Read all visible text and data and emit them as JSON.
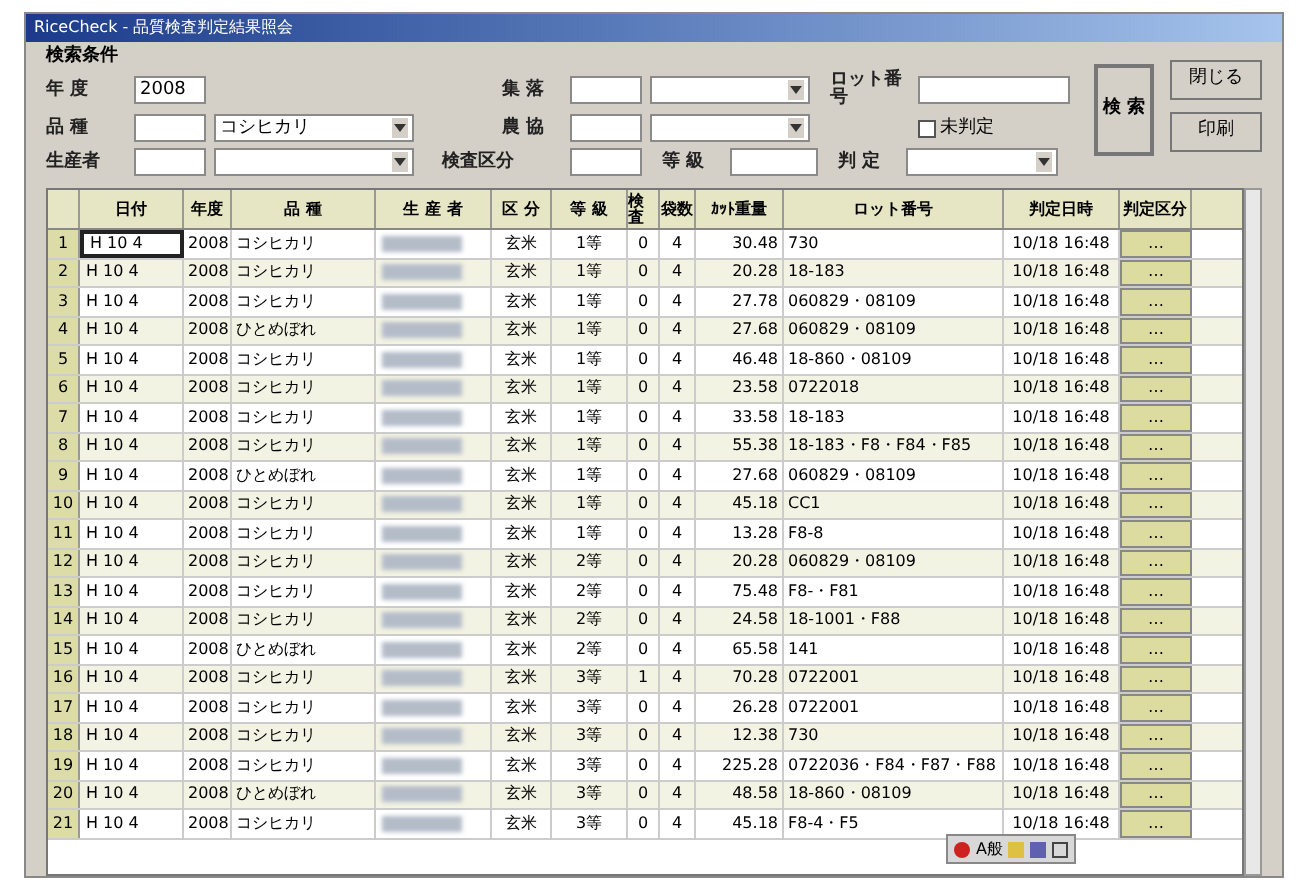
{
  "window": {
    "title": "RiceCheck - 品質検査判定結果照会"
  },
  "search": {
    "heading": "検索条件",
    "fields": [
      {
        "label": "年 度",
        "value": "2008"
      },
      {
        "label": "品 種",
        "value2": "コシヒカリ"
      },
      {
        "label": "生産者"
      },
      {
        "label": "集 落"
      },
      {
        "label": "農 協"
      },
      {
        "label": "検査区分"
      },
      {
        "label": "等 級"
      },
      {
        "label": "ロット番号"
      },
      {
        "label": "判 定"
      }
    ],
    "checkbox": {
      "label": "未判定",
      "checked": false
    },
    "buttons": [
      "検 索",
      "閉じる",
      "印刷"
    ]
  },
  "table": {
    "columns": [
      "",
      "日付",
      "年度",
      "品 種",
      "生 産 者",
      "区 分",
      "等 級",
      "検査",
      "袋数",
      "ｶｯﾄ重量",
      "ロット番号",
      "判定日時",
      "判定区分"
    ],
    "rows": [
      {
        "no": "1",
        "date": "H 10 4",
        "year": "2008",
        "variety": "コシヒカリ",
        "kubun": "玄米",
        "grade": "1等",
        "c1": "0",
        "c2": "4",
        "weight": "30.48",
        "lot": "730",
        "time": "10/18 16:48",
        "judge": "…",
        "selected": true
      },
      {
        "no": "2",
        "date": "H 10 4",
        "year": "2008",
        "variety": "コシヒカリ",
        "kubun": "玄米",
        "grade": "1等",
        "c1": "0",
        "c2": "4",
        "weight": "20.28",
        "lot": "18-183",
        "time": "10/18 16:48",
        "judge": "…",
        "selected": false
      },
      {
        "no": "3",
        "date": "H 10 4",
        "year": "2008",
        "variety": "コシヒカリ",
        "kubun": "玄米",
        "grade": "1等",
        "c1": "0",
        "c2": "4",
        "weight": "27.78",
        "lot": "060829・08109",
        "time": "10/18 16:48",
        "judge": "…",
        "selected": false
      },
      {
        "no": "4",
        "date": "H 10 4",
        "year": "2008",
        "variety": "ひとめぼれ",
        "kubun": "玄米",
        "grade": "1等",
        "c1": "0",
        "c2": "4",
        "weight": "27.68",
        "lot": "060829・08109",
        "time": "10/18 16:48",
        "judge": "…",
        "selected": false
      },
      {
        "no": "5",
        "date": "H 10 4",
        "year": "2008",
        "variety": "コシヒカリ",
        "kubun": "玄米",
        "grade": "1等",
        "c1": "0",
        "c2": "4",
        "weight": "46.48",
        "lot": "18-860・08109",
        "time": "10/18 16:48",
        "judge": "…",
        "selected": false
      },
      {
        "no": "6",
        "date": "H 10 4",
        "year": "2008",
        "variety": "コシヒカリ",
        "kubun": "玄米",
        "grade": "1等",
        "c1": "0",
        "c2": "4",
        "weight": "23.58",
        "lot": "0722018",
        "time": "10/18 16:48",
        "judge": "…",
        "selected": false
      },
      {
        "no": "7",
        "date": "H 10 4",
        "year": "2008",
        "variety": "コシヒカリ",
        "kubun": "玄米",
        "grade": "1等",
        "c1": "0",
        "c2": "4",
        "weight": "33.58",
        "lot": "18-183",
        "time": "10/18 16:48",
        "judge": "…",
        "selected": false
      },
      {
        "no": "8",
        "date": "H 10 4",
        "year": "2008",
        "variety": "コシヒカリ",
        "kubun": "玄米",
        "grade": "1等",
        "c1": "0",
        "c2": "4",
        "weight": "55.38",
        "lot": "18-183・F8・F84・F85",
        "time": "10/18 16:48",
        "judge": "…",
        "selected": false
      },
      {
        "no": "9",
        "date": "H 10 4",
        "year": "2008",
        "variety": "ひとめぼれ",
        "kubun": "玄米",
        "grade": "1等",
        "c1": "0",
        "c2": "4",
        "weight": "27.68",
        "lot": "060829・08109",
        "time": "10/18 16:48",
        "judge": "…",
        "selected": false
      },
      {
        "no": "10",
        "date": "H 10 4",
        "year": "2008",
        "variety": "コシヒカリ",
        "kubun": "玄米",
        "grade": "1等",
        "c1": "0",
        "c2": "4",
        "weight": "45.18",
        "lot": "CC1",
        "time": "10/18 16:48",
        "judge": "…",
        "selected": false
      },
      {
        "no": "11",
        "date": "H 10 4",
        "year": "2008",
        "variety": "コシヒカリ",
        "kubun": "玄米",
        "grade": "1等",
        "c1": "0",
        "c2": "4",
        "weight": "13.28",
        "lot": "F8-8",
        "time": "10/18 16:48",
        "judge": "…",
        "selected": false
      },
      {
        "no": "12",
        "date": "H 10 4",
        "year": "2008",
        "variety": "コシヒカリ",
        "kubun": "玄米",
        "grade": "2等",
        "c1": "0",
        "c2": "4",
        "weight": "20.28",
        "lot": "060829・08109",
        "time": "10/18 16:48",
        "judge": "…",
        "selected": false
      },
      {
        "no": "13",
        "date": "H 10 4",
        "year": "2008",
        "variety": "コシヒカリ",
        "kubun": "玄米",
        "grade": "2等",
        "c1": "0",
        "c2": "4",
        "weight": "75.48",
        "lot": "F8-・F81",
        "time": "10/18 16:48",
        "judge": "…",
        "selected": false
      },
      {
        "no": "14",
        "date": "H 10 4",
        "year": "2008",
        "variety": "コシヒカリ",
        "kubun": "玄米",
        "grade": "2等",
        "c1": "0",
        "c2": "4",
        "weight": "24.58",
        "lot": "18-1001・F88",
        "time": "10/18 16:48",
        "judge": "…",
        "selected": false
      },
      {
        "no": "15",
        "date": "H 10 4",
        "year": "2008",
        "variety": "ひとめぼれ",
        "kubun": "玄米",
        "grade": "2等",
        "c1": "0",
        "c2": "4",
        "weight": "65.58",
        "lot": "141",
        "time": "10/18 16:48",
        "judge": "…",
        "selected": false
      },
      {
        "no": "16",
        "date": "H 10 4",
        "year": "2008",
        "variety": "コシヒカリ",
        "kubun": "玄米",
        "grade": "3等",
        "c1": "1",
        "c2": "4",
        "weight": "70.28",
        "lot": "0722001",
        "time": "10/18 16:48",
        "judge": "…",
        "selected": false
      },
      {
        "no": "17",
        "date": "H 10 4",
        "year": "2008",
        "variety": "コシヒカリ",
        "kubun": "玄米",
        "grade": "3等",
        "c1": "0",
        "c2": "4",
        "weight": "26.28",
        "lot": "0722001",
        "time": "10/18 16:48",
        "judge": "…",
        "selected": false
      },
      {
        "no": "18",
        "date": "H 10 4",
        "year": "2008",
        "variety": "コシヒカリ",
        "kubun": "玄米",
        "grade": "3等",
        "c1": "0",
        "c2": "4",
        "weight": "12.38",
        "lot": "730",
        "time": "10/18 16:48",
        "judge": "…",
        "selected": false
      },
      {
        "no": "19",
        "date": "H 10 4",
        "year": "2008",
        "variety": "コシヒカリ",
        "kubun": "玄米",
        "grade": "3等",
        "c1": "0",
        "c2": "4",
        "weight": "225.28",
        "lot": "0722036・F84・F87・F88",
        "time": "10/18 16:48",
        "judge": "…",
        "selected": false
      },
      {
        "no": "20",
        "date": "H 10 4",
        "year": "2008",
        "variety": "ひとめぼれ",
        "kubun": "玄米",
        "grade": "3等",
        "c1": "0",
        "c2": "4",
        "weight": "48.58",
        "lot": "18-860・08109",
        "time": "10/18 16:48",
        "judge": "…",
        "selected": false
      },
      {
        "no": "21",
        "date": "H 10 4",
        "year": "2008",
        "variety": "コシヒカリ",
        "kubun": "玄米",
        "grade": "3等",
        "c1": "0",
        "c2": "4",
        "weight": "45.18",
        "lot": "F8-4・F5",
        "time": "10/18 16:48",
        "judge": "…",
        "selected": false
      }
    ]
  },
  "ime_toolbar": {
    "label": "A般"
  }
}
